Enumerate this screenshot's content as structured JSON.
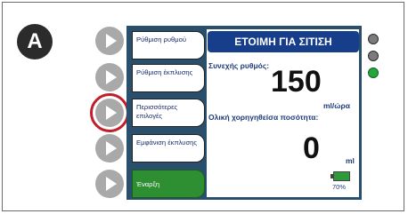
{
  "badge": "A",
  "buttons": [
    {
      "label": "Ρύθμιση ρυθμού"
    },
    {
      "label": "Ρύθμιση έκπλυσης"
    },
    {
      "label": "Περισσότερες επιλογές"
    },
    {
      "label": "Εμφάνιση έκπλυσης"
    },
    {
      "label": "Έναρξη"
    }
  ],
  "status": {
    "title": "ΕΤΟΙΜΗ ΓΙΑ ΣΙΤΙΣΗ"
  },
  "rate": {
    "label": "Συνεχής ρυθμός:",
    "value": "150",
    "unit": "ml/ώρα"
  },
  "total": {
    "label": "Ολική χορηγηθείσα ποσότητα:",
    "value": "0",
    "unit": "ml"
  },
  "battery": {
    "percent_label": "70%",
    "level": 0.7
  },
  "indicators": [
    "gray",
    "gray",
    "green"
  ],
  "colors": {
    "highlight": "#c01f2a",
    "title_bar": "#163e8a",
    "start_button": "#2e8f32",
    "led_green": "#21a83c"
  }
}
